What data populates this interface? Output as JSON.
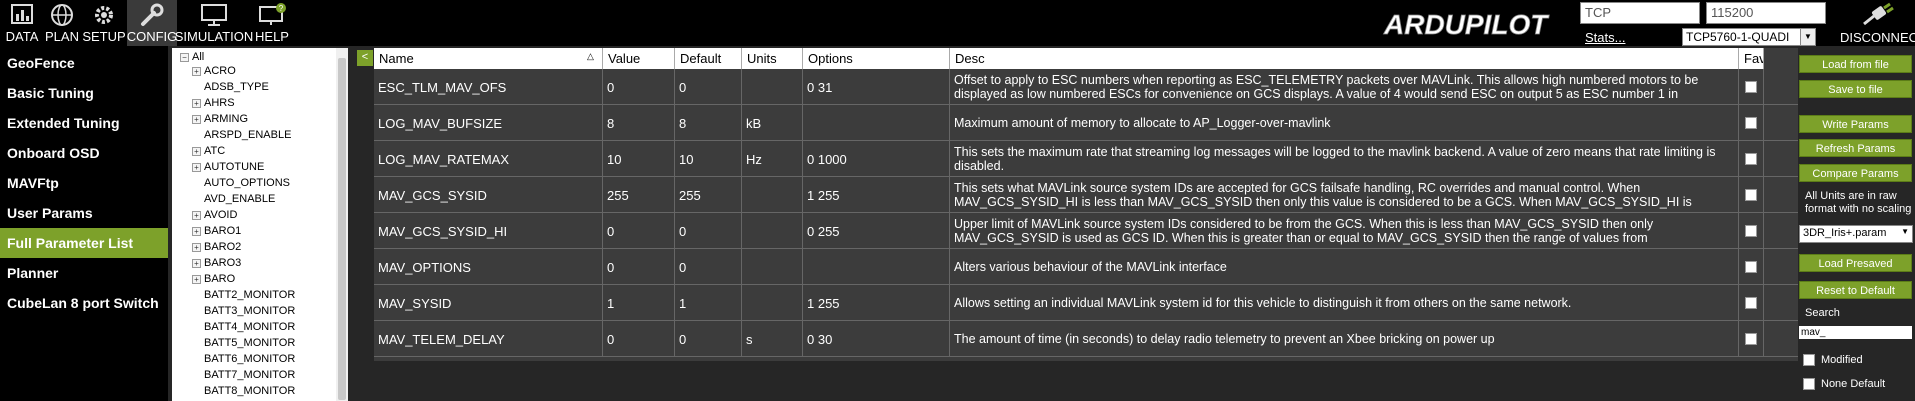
{
  "menu": [
    {
      "label": "DATA",
      "icon": "data-icon"
    },
    {
      "label": "PLAN",
      "icon": "globe-icon"
    },
    {
      "label": "SETUP",
      "icon": "gear-icon"
    },
    {
      "label": "CONFIG",
      "icon": "wrench-icon"
    },
    {
      "label": "SIMULATION",
      "icon": "monitor-icon"
    },
    {
      "label": "HELP",
      "icon": "help-monitor-icon"
    }
  ],
  "logo_text": "ARDUPILOT",
  "connection": {
    "protocol": "TCP",
    "baud": "115200",
    "link": "TCP5760-1-QUADI",
    "stats_label": "Stats...",
    "disconnect_label": "DISCONNECT"
  },
  "nav": [
    {
      "label": "GeoFence"
    },
    {
      "label": "Basic Tuning"
    },
    {
      "label": "Extended Tuning"
    },
    {
      "label": "Onboard OSD"
    },
    {
      "label": "MAVFtp"
    },
    {
      "label": "User Params"
    },
    {
      "label": "Full Parameter List",
      "active": true
    },
    {
      "label": "Planner"
    },
    {
      "label": "CubeLan 8 port Switch"
    }
  ],
  "tree": {
    "root": "All",
    "items": [
      {
        "label": "ACRO",
        "expandable": true
      },
      {
        "label": "ADSB_TYPE",
        "expandable": false
      },
      {
        "label": "AHRS",
        "expandable": true
      },
      {
        "label": "ARMING",
        "expandable": true
      },
      {
        "label": "ARSPD_ENABLE",
        "expandable": false
      },
      {
        "label": "ATC",
        "expandable": true
      },
      {
        "label": "AUTOTUNE",
        "expandable": true
      },
      {
        "label": "AUTO_OPTIONS",
        "expandable": false
      },
      {
        "label": "AVD_ENABLE",
        "expandable": false
      },
      {
        "label": "AVOID",
        "expandable": true
      },
      {
        "label": "BARO1",
        "expandable": true
      },
      {
        "label": "BARO2",
        "expandable": true
      },
      {
        "label": "BARO3",
        "expandable": true
      },
      {
        "label": "BARO",
        "expandable": true
      },
      {
        "label": "BATT2_MONITOR",
        "expandable": false
      },
      {
        "label": "BATT3_MONITOR",
        "expandable": false
      },
      {
        "label": "BATT4_MONITOR",
        "expandable": false
      },
      {
        "label": "BATT5_MONITOR",
        "expandable": false
      },
      {
        "label": "BATT6_MONITOR",
        "expandable": false
      },
      {
        "label": "BATT7_MONITOR",
        "expandable": false
      },
      {
        "label": "BATT8_MONITOR",
        "expandable": false
      }
    ]
  },
  "collapse_glyph": "<",
  "columns": [
    "Name",
    "Value",
    "Default",
    "Units",
    "Options",
    "Desc",
    "Fav"
  ],
  "rows": [
    {
      "name": "ESC_TLM_MAV_OFS",
      "value": "0",
      "default": "0",
      "units": "",
      "options": "0 31",
      "desc": "Offset to apply to ESC numbers when reporting as ESC_TELEMETRY packets over MAVLink. This allows high numbered motors to be displayed as low numbered ESCs for convenience on GCS displays. A value of 4 would send ESC on output 5 as ESC number 1 in"
    },
    {
      "name": "LOG_MAV_BUFSIZE",
      "value": "8",
      "default": "8",
      "units": "kB",
      "options": "",
      "desc": "Maximum amount of memory to allocate to AP_Logger-over-mavlink"
    },
    {
      "name": "LOG_MAV_RATEMAX",
      "value": "10",
      "default": "10",
      "units": "Hz",
      "options": "0 1000",
      "desc": "This sets the maximum rate that streaming log messages will be logged to the mavlink backend. A value of zero means that rate limiting is disabled."
    },
    {
      "name": "MAV_GCS_SYSID",
      "value": "255",
      "default": "255",
      "units": "",
      "options": "1 255",
      "desc": "This sets what MAVLink source system IDs are accepted for GCS failsafe handling, RC overrides and manual control. When MAV_GCS_SYSID_HI is less than MAV_GCS_SYSID then only this value is considered to be a GCS. When MAV_GCS_SYSID_HI is"
    },
    {
      "name": "MAV_GCS_SYSID_HI",
      "value": "0",
      "default": "0",
      "units": "",
      "options": "0 255",
      "desc": "Upper limit of MAVLink source system IDs considered to be from the GCS. When this is less than MAV_GCS_SYSID then only MAV_GCS_SYSID is used as GCS ID. When this is greater than or equal to MAV_GCS_SYSID then the range of values from"
    },
    {
      "name": "MAV_OPTIONS",
      "value": "0",
      "default": "0",
      "units": "",
      "options": "",
      "desc": "Alters various behaviour of the MAVLink interface"
    },
    {
      "name": "MAV_SYSID",
      "value": "1",
      "default": "1",
      "units": "",
      "options": "1 255",
      "desc": "Allows setting an individual MAVLink system id for this vehicle to distinguish it from others on the same network."
    },
    {
      "name": "MAV_TELEM_DELAY",
      "value": "0",
      "default": "0",
      "units": "s",
      "options": "0 30",
      "desc": "The amount of time (in seconds) to delay radio telemetry to prevent an Xbee bricking on power up"
    }
  ],
  "right_panel": {
    "load_file": "Load from file",
    "save_file": "Save to file",
    "write_params": "Write Params",
    "refresh_params": "Refresh Params",
    "compare_params": "Compare Params",
    "units_note": "All Units are in raw format with no scaling",
    "preset": "3DR_Iris+.param",
    "load_presaved": "Load Presaved",
    "reset_default": "Reset to Default",
    "search_label": "Search",
    "search_value": "mav_",
    "modified_label": "Modified",
    "none_default_label": "None Default"
  },
  "colors": {
    "accent": "#7da12a",
    "grid_bg": "#3c3c3c",
    "panel_bg": "#262626"
  }
}
